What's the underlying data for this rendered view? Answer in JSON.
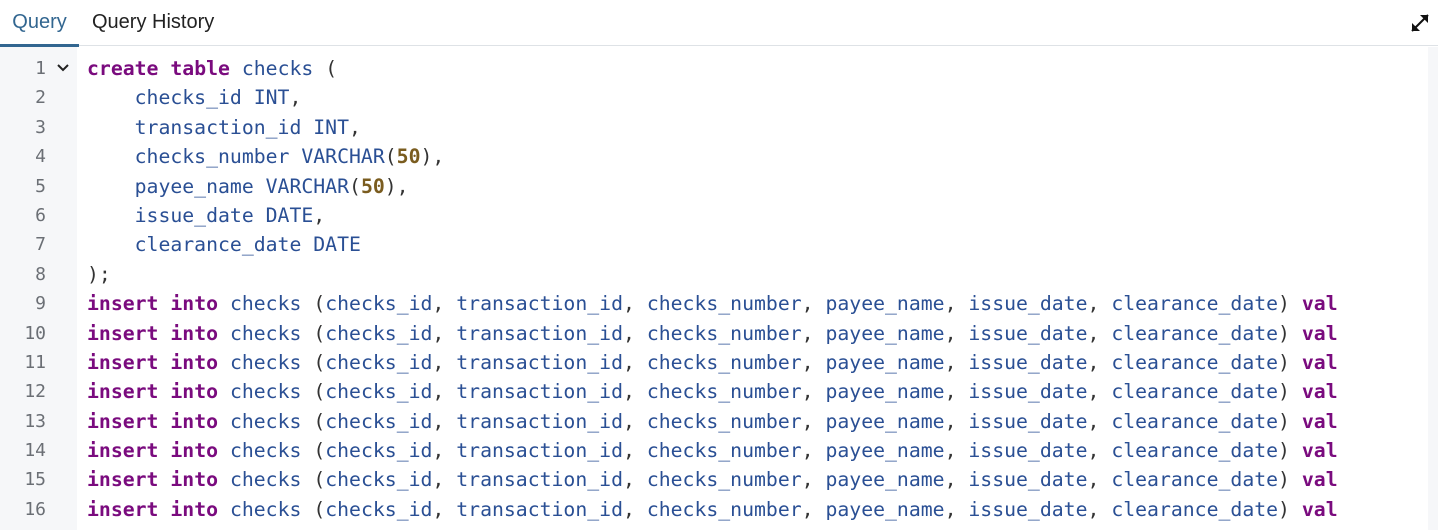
{
  "tabs": {
    "query": "Query",
    "history": "Query History"
  },
  "icons": {
    "expand": "expand-icon",
    "fold": "chevron-down-icon"
  },
  "colors": {
    "tab_active": "#326690",
    "keyword": "#7a0b7e",
    "identifier": "#2a4f94",
    "number": "#7a5c1f",
    "gutter_bg": "#f6f7f9"
  },
  "editor": {
    "lines": [
      {
        "n": "1",
        "fold": true,
        "tokens": [
          {
            "t": "kw",
            "v": "create"
          },
          {
            "t": "sp",
            "v": " "
          },
          {
            "t": "kw",
            "v": "table"
          },
          {
            "t": "id",
            "v": " checks "
          },
          {
            "t": "pun",
            "v": "("
          }
        ]
      },
      {
        "n": "2",
        "tokens": [
          {
            "t": "id",
            "v": "    checks_id INT"
          },
          {
            "t": "pun",
            "v": ","
          }
        ]
      },
      {
        "n": "3",
        "tokens": [
          {
            "t": "id",
            "v": "    transaction_id INT"
          },
          {
            "t": "pun",
            "v": ","
          }
        ]
      },
      {
        "n": "4",
        "tokens": [
          {
            "t": "id",
            "v": "    checks_number VARCHAR"
          },
          {
            "t": "pun",
            "v": "("
          },
          {
            "t": "num",
            "v": "50"
          },
          {
            "t": "pun",
            "v": "),"
          }
        ]
      },
      {
        "n": "5",
        "tokens": [
          {
            "t": "id",
            "v": "    payee_name VARCHAR"
          },
          {
            "t": "pun",
            "v": "("
          },
          {
            "t": "num",
            "v": "50"
          },
          {
            "t": "pun",
            "v": "),"
          }
        ]
      },
      {
        "n": "6",
        "tokens": [
          {
            "t": "id",
            "v": "    issue_date DATE"
          },
          {
            "t": "pun",
            "v": ","
          }
        ]
      },
      {
        "n": "7",
        "tokens": [
          {
            "t": "id",
            "v": "    clearance_date DATE"
          }
        ]
      },
      {
        "n": "8",
        "tokens": [
          {
            "t": "pun",
            "v": ");"
          }
        ]
      },
      {
        "n": "9",
        "tokens": [
          {
            "t": "kw",
            "v": "insert"
          },
          {
            "t": "sp",
            "v": " "
          },
          {
            "t": "kw",
            "v": "into"
          },
          {
            "t": "id",
            "v": " checks "
          },
          {
            "t": "pun",
            "v": "("
          },
          {
            "t": "id",
            "v": "checks_id"
          },
          {
            "t": "pun",
            "v": ", "
          },
          {
            "t": "id",
            "v": "transaction_id"
          },
          {
            "t": "pun",
            "v": ", "
          },
          {
            "t": "id",
            "v": "checks_number"
          },
          {
            "t": "pun",
            "v": ", "
          },
          {
            "t": "id",
            "v": "payee_name"
          },
          {
            "t": "pun",
            "v": ", "
          },
          {
            "t": "id",
            "v": "issue_date"
          },
          {
            "t": "pun",
            "v": ", "
          },
          {
            "t": "id",
            "v": "clearance_date"
          },
          {
            "t": "pun",
            "v": ") "
          },
          {
            "t": "kw",
            "v": "val"
          }
        ]
      },
      {
        "n": "10",
        "tokens": [
          {
            "t": "kw",
            "v": "insert"
          },
          {
            "t": "sp",
            "v": " "
          },
          {
            "t": "kw",
            "v": "into"
          },
          {
            "t": "id",
            "v": " checks "
          },
          {
            "t": "pun",
            "v": "("
          },
          {
            "t": "id",
            "v": "checks_id"
          },
          {
            "t": "pun",
            "v": ", "
          },
          {
            "t": "id",
            "v": "transaction_id"
          },
          {
            "t": "pun",
            "v": ", "
          },
          {
            "t": "id",
            "v": "checks_number"
          },
          {
            "t": "pun",
            "v": ", "
          },
          {
            "t": "id",
            "v": "payee_name"
          },
          {
            "t": "pun",
            "v": ", "
          },
          {
            "t": "id",
            "v": "issue_date"
          },
          {
            "t": "pun",
            "v": ", "
          },
          {
            "t": "id",
            "v": "clearance_date"
          },
          {
            "t": "pun",
            "v": ") "
          },
          {
            "t": "kw",
            "v": "val"
          }
        ]
      },
      {
        "n": "11",
        "tokens": [
          {
            "t": "kw",
            "v": "insert"
          },
          {
            "t": "sp",
            "v": " "
          },
          {
            "t": "kw",
            "v": "into"
          },
          {
            "t": "id",
            "v": " checks "
          },
          {
            "t": "pun",
            "v": "("
          },
          {
            "t": "id",
            "v": "checks_id"
          },
          {
            "t": "pun",
            "v": ", "
          },
          {
            "t": "id",
            "v": "transaction_id"
          },
          {
            "t": "pun",
            "v": ", "
          },
          {
            "t": "id",
            "v": "checks_number"
          },
          {
            "t": "pun",
            "v": ", "
          },
          {
            "t": "id",
            "v": "payee_name"
          },
          {
            "t": "pun",
            "v": ", "
          },
          {
            "t": "id",
            "v": "issue_date"
          },
          {
            "t": "pun",
            "v": ", "
          },
          {
            "t": "id",
            "v": "clearance_date"
          },
          {
            "t": "pun",
            "v": ") "
          },
          {
            "t": "kw",
            "v": "val"
          }
        ]
      },
      {
        "n": "12",
        "tokens": [
          {
            "t": "kw",
            "v": "insert"
          },
          {
            "t": "sp",
            "v": " "
          },
          {
            "t": "kw",
            "v": "into"
          },
          {
            "t": "id",
            "v": " checks "
          },
          {
            "t": "pun",
            "v": "("
          },
          {
            "t": "id",
            "v": "checks_id"
          },
          {
            "t": "pun",
            "v": ", "
          },
          {
            "t": "id",
            "v": "transaction_id"
          },
          {
            "t": "pun",
            "v": ", "
          },
          {
            "t": "id",
            "v": "checks_number"
          },
          {
            "t": "pun",
            "v": ", "
          },
          {
            "t": "id",
            "v": "payee_name"
          },
          {
            "t": "pun",
            "v": ", "
          },
          {
            "t": "id",
            "v": "issue_date"
          },
          {
            "t": "pun",
            "v": ", "
          },
          {
            "t": "id",
            "v": "clearance_date"
          },
          {
            "t": "pun",
            "v": ") "
          },
          {
            "t": "kw",
            "v": "val"
          }
        ]
      },
      {
        "n": "13",
        "tokens": [
          {
            "t": "kw",
            "v": "insert"
          },
          {
            "t": "sp",
            "v": " "
          },
          {
            "t": "kw",
            "v": "into"
          },
          {
            "t": "id",
            "v": " checks "
          },
          {
            "t": "pun",
            "v": "("
          },
          {
            "t": "id",
            "v": "checks_id"
          },
          {
            "t": "pun",
            "v": ", "
          },
          {
            "t": "id",
            "v": "transaction_id"
          },
          {
            "t": "pun",
            "v": ", "
          },
          {
            "t": "id",
            "v": "checks_number"
          },
          {
            "t": "pun",
            "v": ", "
          },
          {
            "t": "id",
            "v": "payee_name"
          },
          {
            "t": "pun",
            "v": ", "
          },
          {
            "t": "id",
            "v": "issue_date"
          },
          {
            "t": "pun",
            "v": ", "
          },
          {
            "t": "id",
            "v": "clearance_date"
          },
          {
            "t": "pun",
            "v": ") "
          },
          {
            "t": "kw",
            "v": "val"
          }
        ]
      },
      {
        "n": "14",
        "tokens": [
          {
            "t": "kw",
            "v": "insert"
          },
          {
            "t": "sp",
            "v": " "
          },
          {
            "t": "kw",
            "v": "into"
          },
          {
            "t": "id",
            "v": " checks "
          },
          {
            "t": "pun",
            "v": "("
          },
          {
            "t": "id",
            "v": "checks_id"
          },
          {
            "t": "pun",
            "v": ", "
          },
          {
            "t": "id",
            "v": "transaction_id"
          },
          {
            "t": "pun",
            "v": ", "
          },
          {
            "t": "id",
            "v": "checks_number"
          },
          {
            "t": "pun",
            "v": ", "
          },
          {
            "t": "id",
            "v": "payee_name"
          },
          {
            "t": "pun",
            "v": ", "
          },
          {
            "t": "id",
            "v": "issue_date"
          },
          {
            "t": "pun",
            "v": ", "
          },
          {
            "t": "id",
            "v": "clearance_date"
          },
          {
            "t": "pun",
            "v": ") "
          },
          {
            "t": "kw",
            "v": "val"
          }
        ]
      },
      {
        "n": "15",
        "tokens": [
          {
            "t": "kw",
            "v": "insert"
          },
          {
            "t": "sp",
            "v": " "
          },
          {
            "t": "kw",
            "v": "into"
          },
          {
            "t": "id",
            "v": " checks "
          },
          {
            "t": "pun",
            "v": "("
          },
          {
            "t": "id",
            "v": "checks_id"
          },
          {
            "t": "pun",
            "v": ", "
          },
          {
            "t": "id",
            "v": "transaction_id"
          },
          {
            "t": "pun",
            "v": ", "
          },
          {
            "t": "id",
            "v": "checks_number"
          },
          {
            "t": "pun",
            "v": ", "
          },
          {
            "t": "id",
            "v": "payee_name"
          },
          {
            "t": "pun",
            "v": ", "
          },
          {
            "t": "id",
            "v": "issue_date"
          },
          {
            "t": "pun",
            "v": ", "
          },
          {
            "t": "id",
            "v": "clearance_date"
          },
          {
            "t": "pun",
            "v": ") "
          },
          {
            "t": "kw",
            "v": "val"
          }
        ]
      },
      {
        "n": "16",
        "tokens": [
          {
            "t": "kw",
            "v": "insert"
          },
          {
            "t": "sp",
            "v": " "
          },
          {
            "t": "kw",
            "v": "into"
          },
          {
            "t": "id",
            "v": " checks "
          },
          {
            "t": "pun",
            "v": "("
          },
          {
            "t": "id",
            "v": "checks_id"
          },
          {
            "t": "pun",
            "v": ", "
          },
          {
            "t": "id",
            "v": "transaction_id"
          },
          {
            "t": "pun",
            "v": ", "
          },
          {
            "t": "id",
            "v": "checks_number"
          },
          {
            "t": "pun",
            "v": ", "
          },
          {
            "t": "id",
            "v": "payee_name"
          },
          {
            "t": "pun",
            "v": ", "
          },
          {
            "t": "id",
            "v": "issue_date"
          },
          {
            "t": "pun",
            "v": ", "
          },
          {
            "t": "id",
            "v": "clearance_date"
          },
          {
            "t": "pun",
            "v": ") "
          },
          {
            "t": "kw",
            "v": "val"
          }
        ]
      }
    ]
  }
}
